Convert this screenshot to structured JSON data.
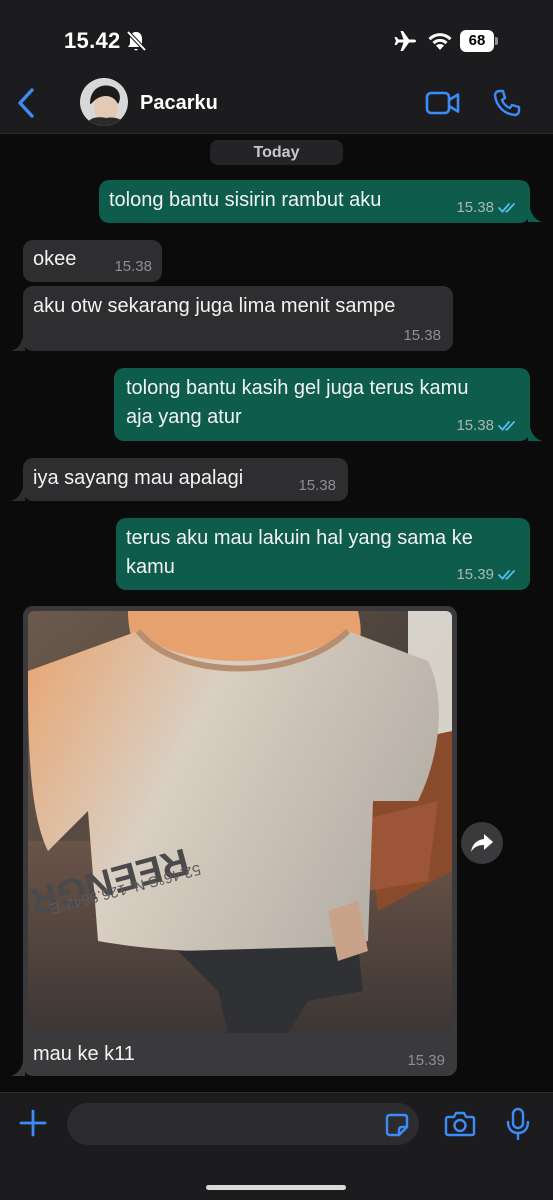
{
  "status_bar": {
    "time": "15.42",
    "battery": "68"
  },
  "header": {
    "contact_name": "Pacarku",
    "avatar": "contact-photo"
  },
  "chat": {
    "date_label": "Today",
    "messages": [
      {
        "direction": "out",
        "text": "tolong bantu sisirin rambut aku",
        "time": "15.38",
        "status": "read"
      },
      {
        "direction": "in",
        "text": "okee",
        "time": "15.38"
      },
      {
        "direction": "in",
        "text": "aku otw sekarang juga lima menit sampe",
        "time": "15.38"
      },
      {
        "direction": "out",
        "text_line1": "tolong bantu kasih gel juga terus kamu",
        "text_line2": "aja yang atur",
        "time": "15.38",
        "status": "read"
      },
      {
        "direction": "in",
        "text": "iya sayang mau apalagi",
        "time": "15.38"
      },
      {
        "direction": "out",
        "text_line1": "terus aku mau lakuin hal yang sama ke",
        "text_line2": "kamu",
        "time": "15.39",
        "status": "read"
      },
      {
        "direction": "in",
        "type": "image",
        "caption": "mau ke k11",
        "time": "15.39",
        "shirt_print": "REENGREEN",
        "shirt_subprint": "52.46°S N. 126.9642°E"
      }
    ]
  },
  "input": {
    "placeholder": ""
  },
  "icons": {
    "back": "chevron-left-icon",
    "video": "video-camera-icon",
    "call": "phone-icon",
    "plus": "plus-icon",
    "sticker": "sticker-icon",
    "camera": "camera-icon",
    "mic": "microphone-icon",
    "forward": "forward-icon"
  },
  "colors": {
    "accent": "#3b8cf7",
    "outgoing_bubble": "#0d5c4c",
    "incoming_bubble": "#2e2e30",
    "read_ticks": "#53bdeb"
  }
}
